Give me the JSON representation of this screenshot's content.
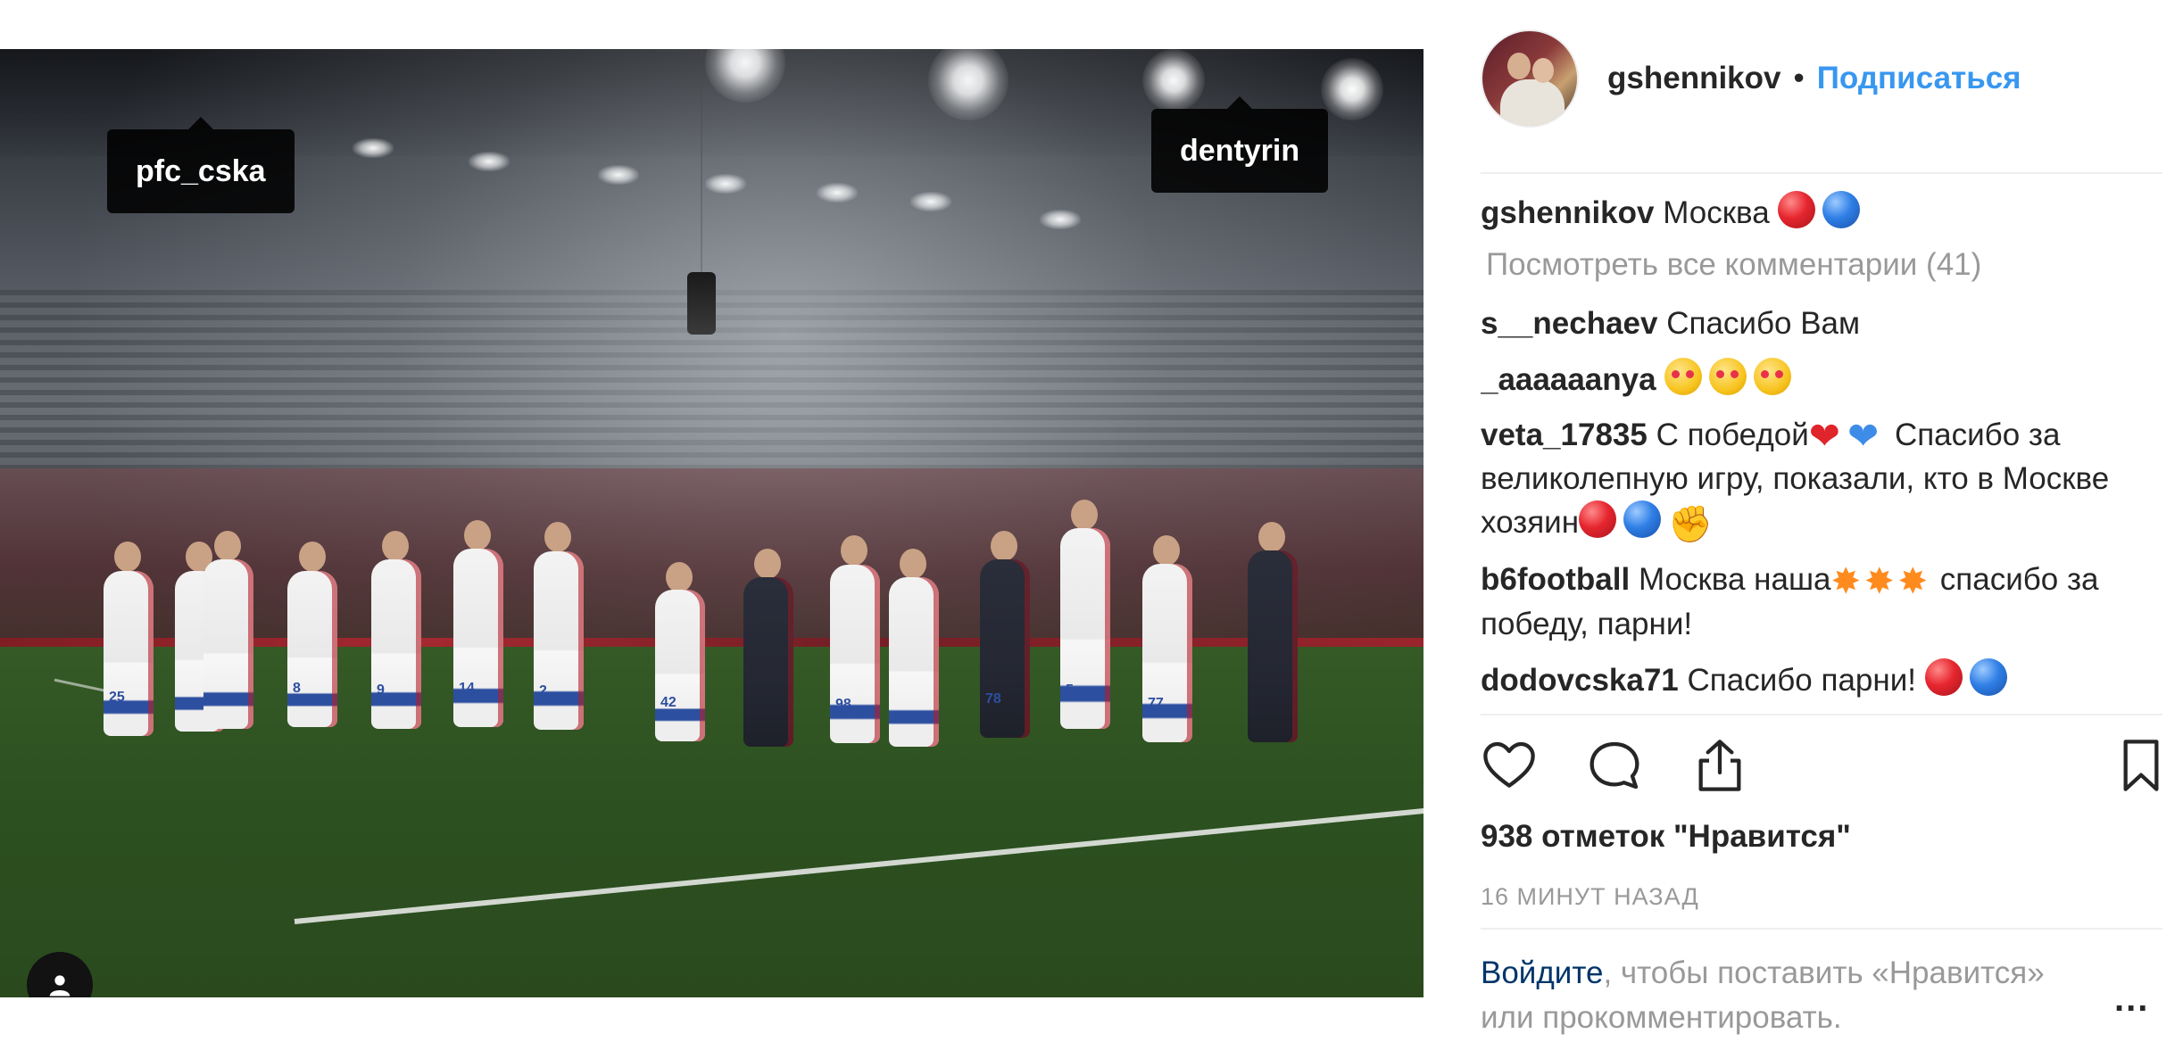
{
  "photo": {
    "tags": [
      {
        "label": "pfc_cska"
      },
      {
        "label": "dentyrin"
      }
    ],
    "jersey_numbers": [
      "25",
      "8",
      "9",
      "14",
      "2",
      "42",
      "98",
      "78",
      "5",
      "77"
    ]
  },
  "post": {
    "username": "gshennikov",
    "separator": "•",
    "follow_label": "Подписаться",
    "caption": {
      "user": "gshennikov",
      "text": "Москва"
    },
    "view_all_comments": "Посмотреть все комментарии (41)",
    "comments": [
      {
        "user": "s__nechaev",
        "text": "Спасибо Вам"
      },
      {
        "user": "_aaaaaanya",
        "text": ""
      },
      {
        "user": "veta_17835",
        "text_a": "С победой",
        "text_b": "Спасибо за великолепную игру, показали, кто в Москве хозяин"
      },
      {
        "user": "b6football",
        "text_a": "Москва наша",
        "text_b": "спасибо за победу, парни!"
      },
      {
        "user": "dodovcska71",
        "text": "Спасибо парни!"
      }
    ],
    "likes": "938 отметок \"Нравится\"",
    "time": "16 минут назад",
    "login_link": "Войдите",
    "login_text": ", чтобы поставить «Нравится» или прокомментировать.",
    "more": "..."
  },
  "icons": {
    "like": "heart-outline-icon",
    "comment": "comment-bubble-icon",
    "share": "share-upload-icon",
    "save": "bookmark-icon",
    "user_tag": "user-tag-icon"
  },
  "colors": {
    "accent": "#3897f0",
    "link": "#003569",
    "muted": "#999999",
    "text": "#262626"
  }
}
